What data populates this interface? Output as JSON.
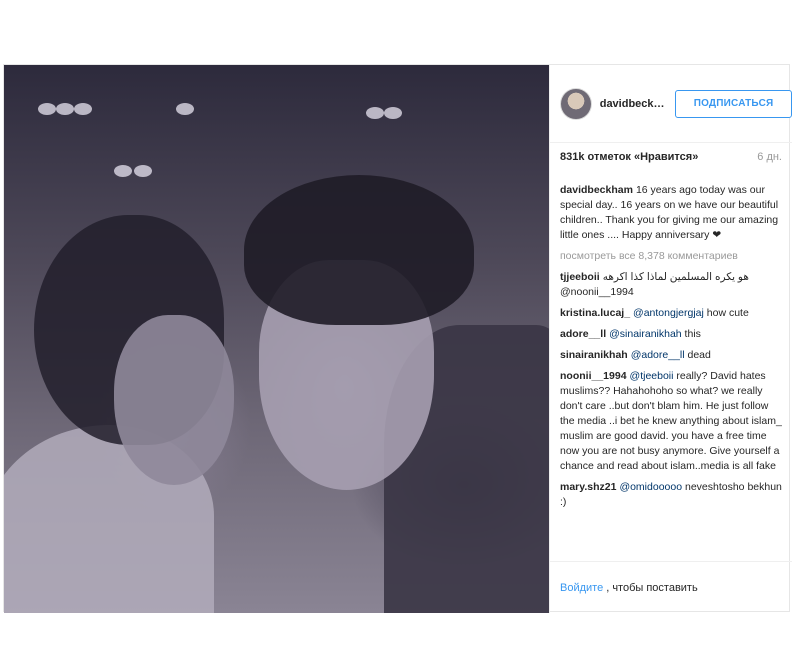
{
  "header": {
    "username": "davidbeck…",
    "follow_label": "ПОДПИСАТЬСЯ"
  },
  "meta": {
    "likes": "831k отметок «Нравится»",
    "time": "6 дн."
  },
  "caption": {
    "user": "davidbeckham",
    "text": "16 years ago today was our special day.. 16 years on we have our beautiful children.. Thank you for giving me our amazing little ones .... Happy anniversary ❤"
  },
  "view_all": "посмотреть все 8,378 комментариев",
  "comments": [
    {
      "user": "tjjeeboii",
      "mention": "",
      "text": "هو يكره المسلمين لماذا كذا اكرهه @noonii__1994"
    },
    {
      "user": "kristina.lucaj_",
      "mention": "@antongjergjaj",
      "text": " how cute"
    },
    {
      "user": "adore__ll",
      "mention": "@sinairanikhah",
      "text": " this"
    },
    {
      "user": "sinairanikhah",
      "mention": "@adore__ll",
      "text": " dead"
    },
    {
      "user": "noonii__1994",
      "mention": "@tjeeboii",
      "text": " really? David hates muslims?? Hahahohoho so what? we really don't care ..but don't blam him. He just follow the media ..i bet he knew anything about islam_ muslim are good david. you have a free time now you are not busy anymore. Give yourself a chance and read about islam..media is all fake"
    },
    {
      "user": "mary.shz21",
      "mention": "@omidooooo",
      "text": " neveshtosho bekhun :)"
    }
  ],
  "footer": {
    "login": "Войдите",
    "rest": ", чтобы поставить «Нрави…"
  },
  "icons": {
    "avatar": "avatar-image"
  },
  "colors": {
    "accent": "#3897f0",
    "mention": "#003569",
    "muted": "#999999"
  }
}
